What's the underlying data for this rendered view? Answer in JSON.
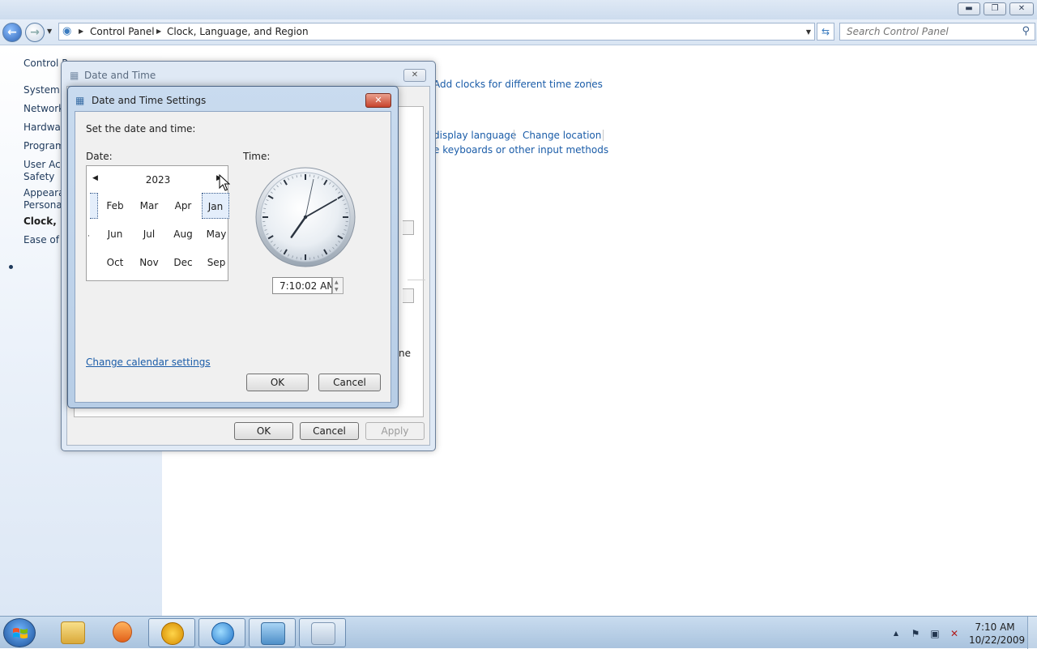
{
  "explorer": {
    "breadcrumb": [
      "Control Panel",
      "Clock, Language, and Region"
    ],
    "search_placeholder": "Search Control Panel",
    "left_pane": [
      "Control P",
      "System a",
      "Network",
      "Hardwar",
      "Program",
      "User Acc",
      "Safety",
      "Appearan",
      "Personal",
      "Clock, La",
      "Ease of A"
    ],
    "links": {
      "add_clocks": "Add clocks for different time zones",
      "display_language": "display language",
      "change_location": "Change location",
      "keyboards": "e keyboards or other input methods"
    }
  },
  "date_time_dialog": {
    "title": "Date and Time",
    "partial_text": "ne",
    "ok_label": "OK",
    "cancel_label": "Cancel",
    "apply_label": "Apply"
  },
  "settings_dialog": {
    "title": "Date and Time Settings",
    "instruction": "Set the date and time:",
    "date_label": "Date:",
    "time_label": "Time:",
    "calendar": {
      "year": "2023",
      "selected": "Jan",
      "months": [
        [
          "Feb",
          "Mar",
          "Apr",
          "Jan"
        ],
        [
          "Jun",
          "Jul",
          "Aug",
          "May"
        ],
        [
          "Oct",
          "Nov",
          "Dec",
          "Sep"
        ]
      ]
    },
    "clock": {
      "hours": 7,
      "minutes": 10,
      "seconds": 2
    },
    "time_value": "7:10:02 AM",
    "calendar_settings_link": "Change calendar settings",
    "ok_label": "OK",
    "cancel_label": "Cancel"
  },
  "taskbar": {
    "clock_time": "7:10 AM",
    "clock_date": "10/22/2009"
  },
  "colors": {
    "link": "#1a5ca8",
    "selection": "#e4eefb",
    "close_red": "#c7432d"
  }
}
